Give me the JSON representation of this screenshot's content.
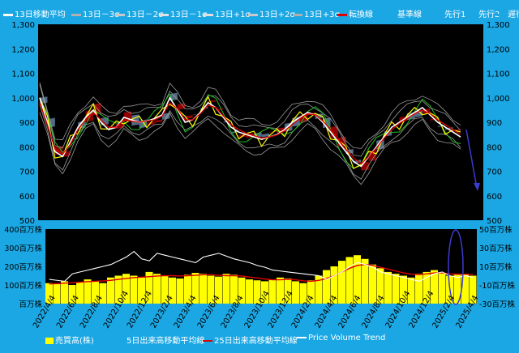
{
  "top_legend": [
    {
      "label": "13日移動平均",
      "color": "#ffffff"
    },
    {
      "label": "13日－3σ",
      "color": "#b0b0b0"
    },
    {
      "label": "13日－2σ",
      "color": "#c8c8c8"
    },
    {
      "label": "13日－1σ",
      "color": "#e0e0e0"
    },
    {
      "label": "13日+1σ",
      "color": "#e0e0e0"
    },
    {
      "label": "13日+2σ",
      "color": "#c8c8c8"
    },
    {
      "label": "13日+3σ",
      "color": "#b0b0b0"
    },
    {
      "label": "転換線",
      "color": "#e00000"
    },
    {
      "label": "基準線",
      "color": "#1aa7e4"
    },
    {
      "label": "先行1",
      "color": "#1aa7e4"
    },
    {
      "label": "先行2",
      "color": "#1aa7e4"
    },
    {
      "label": "遅行",
      "color": "#1aa7e4"
    }
  ],
  "bottom_legend": [
    {
      "label": "売買高(株)",
      "color": "#ffff00",
      "kind": "box"
    },
    {
      "label": "5日出来高移動平均線",
      "color": "#1aa7e4",
      "kind": "line"
    },
    {
      "label": "25日出来高移動平均線",
      "color": "#e00000",
      "kind": "line"
    },
    {
      "label": "Price Volume Trend",
      "color": "#ffffff",
      "kind": "line"
    }
  ],
  "chart_data": [
    {
      "type": "line",
      "name": "price_panel",
      "ylim": [
        500,
        1300
      ],
      "yticks": [
        "500",
        "600",
        "700",
        "800",
        "900",
        "1,000",
        "1,100",
        "1,200",
        "1,300"
      ],
      "right_yticks": [
        "500",
        "600",
        "700",
        "800",
        "900",
        "1,000",
        "1,100",
        "1,200",
        "1,300"
      ],
      "grid": false,
      "series": [
        {
          "label": "13日移動平均",
          "color": "#ffffff",
          "values": [
            1000,
            900,
            780,
            760,
            820,
            880,
            920,
            950,
            900,
            870,
            880,
            920,
            910,
            900,
            905,
            915,
            930,
            1000,
            950,
            900,
            910,
            940,
            980,
            960,
            920,
            880,
            860,
            850,
            840,
            830,
            840,
            850,
            870,
            900,
            920,
            940,
            930,
            900,
            860,
            820,
            780,
            740,
            720,
            760,
            800,
            840,
            880,
            900,
            920,
            940,
            960,
            930,
            900,
            880,
            860,
            840
          ]
        },
        {
          "label": "転換線",
          "color": "#e00000",
          "values": [
            980,
            890,
            790,
            770,
            810,
            870,
            910,
            940,
            910,
            880,
            880,
            910,
            905,
            900,
            905,
            910,
            925,
            980,
            955,
            910,
            910,
            935,
            970,
            960,
            925,
            890,
            870,
            855,
            845,
            835,
            840,
            848,
            865,
            890,
            915,
            935,
            930,
            905,
            870,
            830,
            790,
            755,
            730,
            760,
            795,
            835,
            870,
            895,
            915,
            935,
            950,
            935,
            910,
            890,
            870,
            850
          ]
        }
      ]
    },
    {
      "type": "bar",
      "name": "volume_panel",
      "left_yticks": [
        "百万株",
        "100百万株",
        "200百万株",
        "300百万株",
        "400百万株"
      ],
      "right_yticks": [
        "-30百万株",
        "-10百万株",
        "10百万株",
        "30百万株",
        "50百万株"
      ],
      "ylim": [
        0,
        400
      ],
      "categories": [
        "2022/4/4",
        "2022/6/4",
        "2022/8/4",
        "2022/10/4",
        "2022/12/4",
        "2023/2/4",
        "2023/4/4",
        "2023/6/4",
        "2023/8/4",
        "2023/10/4",
        "2023/12/4",
        "2024/2/4",
        "2024/4/4",
        "2024/6/4",
        "2024/8/4",
        "2024/10/4",
        "2024/12/4",
        "2025/2/4",
        "2025/4/4"
      ],
      "volume_values": [
        110,
        105,
        120,
        100,
        115,
        130,
        120,
        110,
        140,
        150,
        160,
        150,
        140,
        170,
        160,
        150,
        140,
        135,
        155,
        165,
        160,
        150,
        145,
        160,
        155,
        140,
        130,
        125,
        120,
        130,
        140,
        135,
        120,
        110,
        125,
        150,
        180,
        200,
        230,
        250,
        260,
        240,
        210,
        190,
        170,
        160,
        150,
        140,
        160,
        170,
        180,
        165,
        150,
        155,
        160,
        150
      ],
      "ma25_values": [
        105,
        108,
        110,
        112,
        115,
        118,
        120,
        122,
        125,
        130,
        135,
        140,
        142,
        145,
        148,
        150,
        150,
        148,
        150,
        152,
        155,
        155,
        152,
        150,
        150,
        148,
        142,
        138,
        132,
        128,
        128,
        130,
        128,
        122,
        120,
        125,
        135,
        150,
        170,
        190,
        205,
        210,
        205,
        195,
        185,
        175,
        165,
        158,
        155,
        160,
        165,
        165,
        160,
        158,
        158,
        155
      ],
      "pvt_values": [
        130,
        125,
        120,
        160,
        170,
        180,
        190,
        200,
        210,
        230,
        250,
        280,
        240,
        230,
        270,
        260,
        250,
        240,
        230,
        220,
        250,
        260,
        270,
        255,
        240,
        230,
        220,
        205,
        195,
        180,
        175,
        170,
        165,
        160,
        155,
        150,
        130,
        150,
        170,
        200,
        220,
        210,
        195,
        170,
        160,
        150,
        140,
        130,
        120,
        140,
        160,
        170,
        150,
        140,
        150,
        140
      ]
    }
  ]
}
